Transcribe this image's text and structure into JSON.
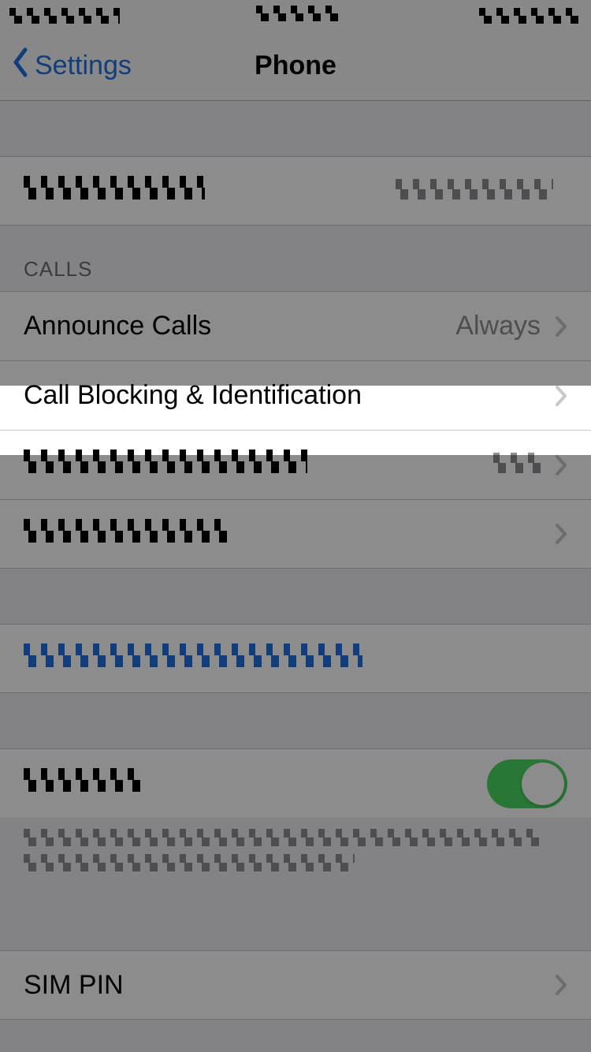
{
  "nav": {
    "back_label": "Settings",
    "title": "Phone"
  },
  "groups": {
    "top": {
      "my_number_label": "[redacted]",
      "my_number_value": "[redacted]"
    },
    "calls": {
      "header": "CALLS",
      "announce_label": "Announce Calls",
      "announce_value": "Always",
      "blocking_label": "Call Blocking & Identification",
      "other_devices_label": "[redacted]",
      "other_devices_value": "Off",
      "wifi_calling_label": "[redacted]"
    },
    "contacts": {
      "change_pw_label": "[redacted]"
    },
    "tty": {
      "label": "[redacted]",
      "toggle_on": true,
      "footer": "[redacted]"
    },
    "sim": {
      "sim_pin_label": "SIM PIN"
    }
  },
  "colors": {
    "ios_blue": "#1f6fe0",
    "ios_green": "#4cd964",
    "cell_bg": "#ffffff",
    "group_bg": "#efeff4",
    "secondary_text": "#8e8e93"
  }
}
